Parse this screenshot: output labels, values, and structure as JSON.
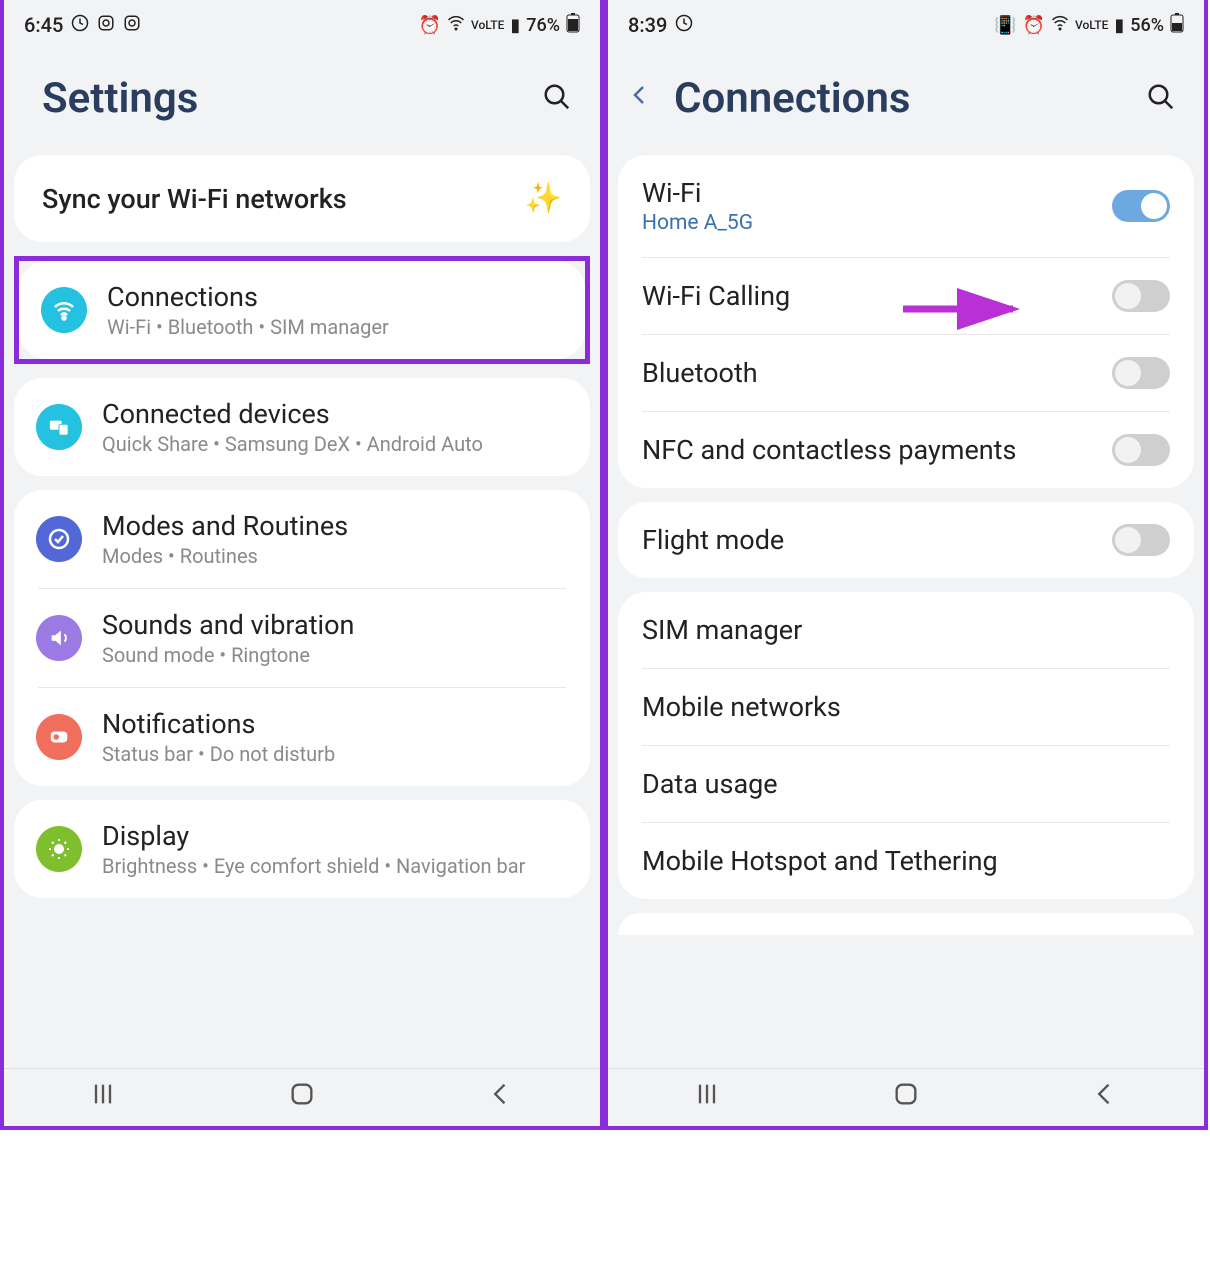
{
  "left": {
    "status": {
      "time": "6:45",
      "battery": "76%"
    },
    "headerTitle": "Settings",
    "syncCard": "Sync your Wi-Fi networks",
    "groups": [
      {
        "highlighted": true,
        "items": [
          {
            "icon": "icon-wifi",
            "title": "Connections",
            "sub": "Wi-Fi  •  Bluetooth  •  SIM manager"
          }
        ]
      },
      {
        "items": [
          {
            "icon": "icon-devices",
            "title": "Connected devices",
            "sub": "Quick Share  •  Samsung DeX  •  Android Auto"
          }
        ]
      },
      {
        "items": [
          {
            "icon": "icon-modes",
            "title": "Modes and Routines",
            "sub": "Modes  •  Routines"
          },
          {
            "icon": "icon-sounds",
            "title": "Sounds and vibration",
            "sub": "Sound mode  •  Ringtone"
          },
          {
            "icon": "icon-notif",
            "title": "Notifications",
            "sub": "Status bar  •  Do not disturb"
          }
        ]
      },
      {
        "items": [
          {
            "icon": "icon-display",
            "title": "Display",
            "sub": "Brightness  •  Eye comfort shield  •  Navigation bar"
          }
        ]
      }
    ]
  },
  "right": {
    "status": {
      "time": "8:39",
      "battery": "56%"
    },
    "headerTitle": "Connections",
    "cards": [
      {
        "items": [
          {
            "title": "Wi-Fi",
            "sub": "Home A_5G",
            "toggle": "on"
          },
          {
            "title": "Wi-Fi Calling",
            "toggle": "off",
            "arrow": true
          },
          {
            "title": "Bluetooth",
            "toggle": "off"
          },
          {
            "title": "NFC and contactless payments",
            "toggle": "off"
          }
        ]
      },
      {
        "items": [
          {
            "title": "Flight mode",
            "toggle": "off"
          }
        ]
      },
      {
        "items": [
          {
            "title": "SIM manager"
          },
          {
            "title": "Mobile networks"
          },
          {
            "title": "Data usage"
          },
          {
            "title": "Mobile Hotspot and Tethering"
          }
        ]
      }
    ]
  }
}
